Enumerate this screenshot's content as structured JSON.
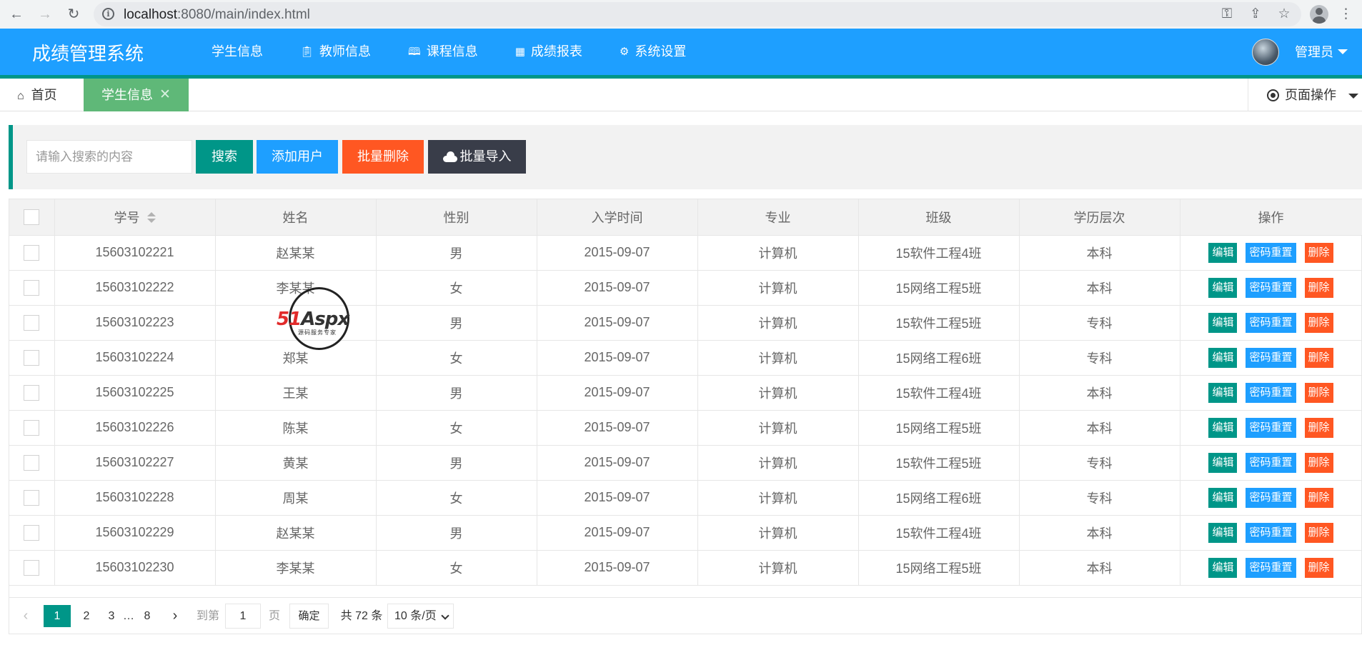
{
  "browser": {
    "url_host": "localhost",
    "url_path": ":8080/main/index.html"
  },
  "header": {
    "brand": "成绩管理系统",
    "nav": [
      {
        "label": "学生信息",
        "icon": "",
        "active": true
      },
      {
        "label": "教师信息",
        "icon": "clipboard-icon",
        "active": false
      },
      {
        "label": "课程信息",
        "icon": "book-icon",
        "active": false
      },
      {
        "label": "成绩报表",
        "icon": "table-icon",
        "active": false
      },
      {
        "label": "系统设置",
        "icon": "gear-icon",
        "active": false
      }
    ],
    "user": "管理员"
  },
  "tabs": {
    "home": "首页",
    "current": "学生信息",
    "close": "✕",
    "page_ops": "页面操作"
  },
  "toolbar": {
    "search_placeholder": "请输入搜索的内容",
    "search": "搜索",
    "add_user": "添加用户",
    "batch_delete": "批量删除",
    "batch_import": "批量导入"
  },
  "table": {
    "headers": [
      "学号",
      "姓名",
      "性别",
      "入学时间",
      "专业",
      "班级",
      "学历层次",
      "操作"
    ],
    "rows": [
      [
        "15603102221",
        "赵某某",
        "男",
        "2015-09-07",
        "计算机",
        "15软件工程4班",
        "本科"
      ],
      [
        "15603102222",
        "李某某",
        "女",
        "2015-09-07",
        "计算机",
        "15网络工程5班",
        "本科"
      ],
      [
        "15603102223",
        "",
        "男",
        "2015-09-07",
        "计算机",
        "15软件工程5班",
        "专科"
      ],
      [
        "15603102224",
        "郑某",
        "女",
        "2015-09-07",
        "计算机",
        "15网络工程6班",
        "专科"
      ],
      [
        "15603102225",
        "王某",
        "男",
        "2015-09-07",
        "计算机",
        "15软件工程4班",
        "本科"
      ],
      [
        "15603102226",
        "陈某",
        "女",
        "2015-09-07",
        "计算机",
        "15网络工程5班",
        "本科"
      ],
      [
        "15603102227",
        "黄某",
        "男",
        "2015-09-07",
        "计算机",
        "15软件工程5班",
        "专科"
      ],
      [
        "15603102228",
        "周某",
        "女",
        "2015-09-07",
        "计算机",
        "15网络工程6班",
        "专科"
      ],
      [
        "15603102229",
        "赵某某",
        "男",
        "2015-09-07",
        "计算机",
        "15软件工程4班",
        "本科"
      ],
      [
        "15603102230",
        "李某某",
        "女",
        "2015-09-07",
        "计算机",
        "15网络工程5班",
        "本科"
      ]
    ],
    "actions": {
      "edit": "编辑",
      "reset": "密码重置",
      "delete": "删除"
    }
  },
  "pager": {
    "pages": [
      "1",
      "2",
      "3",
      "…",
      "8"
    ],
    "goto": "到第",
    "goto_value": "1",
    "unit": "页",
    "confirm": "确定",
    "total": "共 72 条",
    "page_size": "10 条/页"
  },
  "watermark": {
    "mark": "51Aspx",
    "mark_red": "51",
    "mark_dark": "Aspx",
    "tagline": "源码服务专家"
  },
  "colors": {
    "header": "#1e9fff",
    "accent": "#009688",
    "active_tab": "#5fb878",
    "danger": "#ff5722",
    "dark": "#393d49"
  }
}
